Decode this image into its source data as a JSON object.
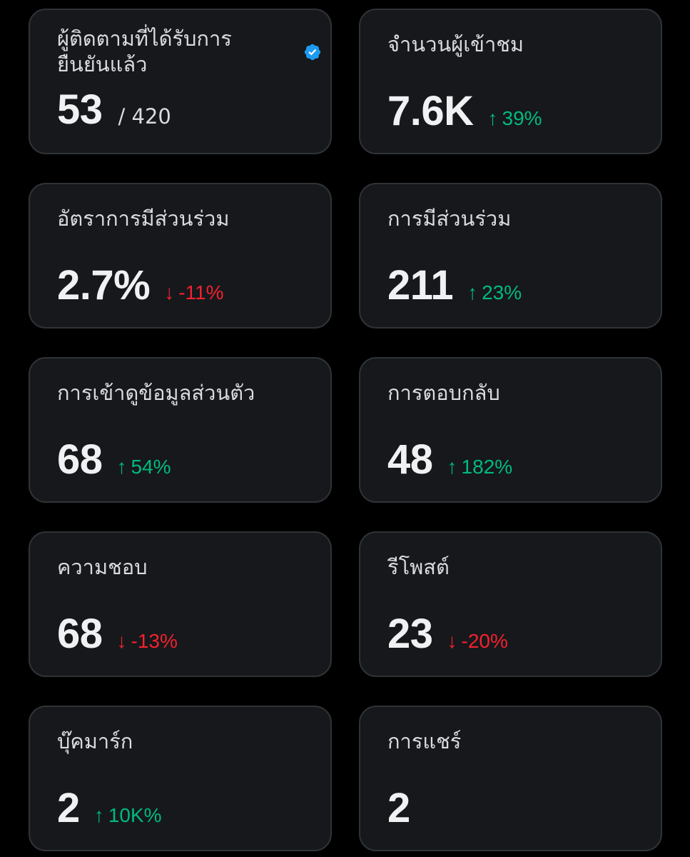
{
  "colors": {
    "background": "#000000",
    "card_background": "#16181c",
    "card_border": "#2f3336",
    "positive": "#00ba7c",
    "negative": "#f4212e",
    "verified_badge": "#1d9bf0"
  },
  "cards": [
    {
      "label": "ผู้ติดตามที่ได้รับการยืนยันแล้ว",
      "value": "53",
      "total": "/ 420",
      "icon": "verified-badge-icon"
    },
    {
      "label": "จำนวนผู้เข้าชม",
      "value": "7.6K",
      "change": "39%",
      "direction": "up",
      "arrow": "↑"
    },
    {
      "label": "อัตราการมีส่วนร่วม",
      "value": "2.7%",
      "change": "-11%",
      "direction": "down",
      "arrow": "↓"
    },
    {
      "label": "การมีส่วนร่วม",
      "value": "211",
      "change": "23%",
      "direction": "up",
      "arrow": "↑"
    },
    {
      "label": "การเข้าดูข้อมูลส่วนตัว",
      "value": "68",
      "change": "54%",
      "direction": "up",
      "arrow": "↑"
    },
    {
      "label": "การตอบกลับ",
      "value": "48",
      "change": "182%",
      "direction": "up",
      "arrow": "↑"
    },
    {
      "label": "ความชอบ",
      "value": "68",
      "change": "-13%",
      "direction": "down",
      "arrow": "↓"
    },
    {
      "label": "รีโพสต์",
      "value": "23",
      "change": "-20%",
      "direction": "down",
      "arrow": "↓"
    },
    {
      "label": "บุ๊คมาร์ก",
      "value": "2",
      "change": "10K%",
      "direction": "up",
      "arrow": "↑"
    },
    {
      "label": "การแชร์",
      "value": "2"
    }
  ]
}
